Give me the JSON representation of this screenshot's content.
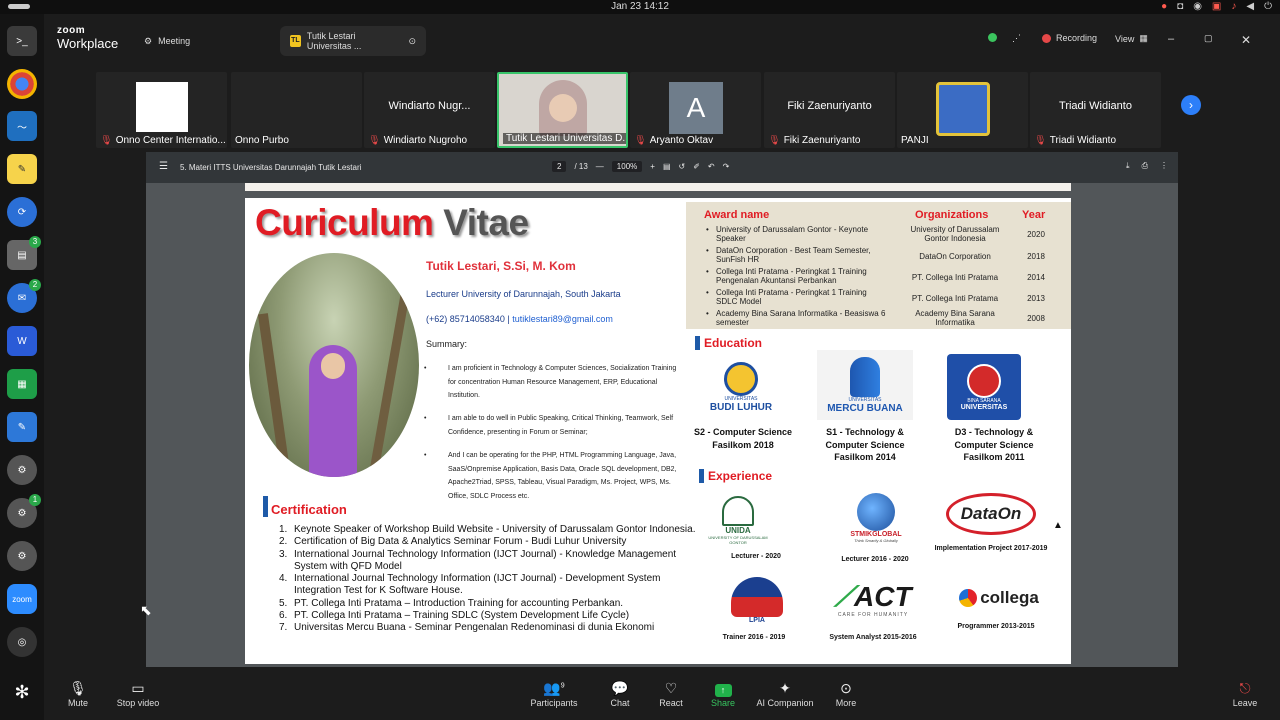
{
  "os": {
    "clock": "Jan 23  14:12"
  },
  "dock": {
    "badges": [
      "3",
      "2",
      "1"
    ],
    "zoom_label": "zoom"
  },
  "app": {
    "brand_line1": "zoom",
    "brand_line2": "Workplace",
    "tab_meeting": "Meeting",
    "tab_presentation": "Tutik Lestari Universitas ...",
    "tab_presentation_initials": "TL",
    "recording_label": "Recording",
    "view_label": "View"
  },
  "participants": [
    {
      "caption": "Onno Center Internatio...",
      "muted": true,
      "display": "logo"
    },
    {
      "caption": "Onno Purbo",
      "muted": false,
      "display": ""
    },
    {
      "caption": "Windiarto Nugroho",
      "muted": true,
      "display": "Windiarto Nugr..."
    },
    {
      "caption": "Tutik Lestari Universitas D...",
      "muted": false,
      "display": "video",
      "active": true
    },
    {
      "caption": "Aryanto Oktav",
      "muted": true,
      "display": "A"
    },
    {
      "caption": "Fiki Zaenuriyanto",
      "muted": true,
      "display": "Fiki Zaenuriyanto"
    },
    {
      "caption": "PANJI",
      "muted": false,
      "display": "logo"
    },
    {
      "caption": "Triadi Widianto",
      "muted": true,
      "display": "Triadi Widianto"
    }
  ],
  "pdf": {
    "file_title": "5. Materi ITTS Universitas Darunnajah Tutik Lestari",
    "page_current": "2",
    "page_total": "/ 13",
    "zoom": "100%"
  },
  "slide": {
    "title_part1": "Curiculum",
    "title_part2": "Vitae",
    "name": "Tutik Lestari, S.Si, M. Kom",
    "role": "Lecturer University of Darunnajah, South Jakarta",
    "phone": "(+62) 85714058340 |",
    "email": "tutiklestari89@gmail.com",
    "summary_heading": "Summary:",
    "summary": [
      "I am proficient in Technology & Computer Sciences, Socialization Training for concentration Human Resource Management, ERP, Educational Institution.",
      "I am able to do well in Public Speaking, Critical Thinking, Teamwork, Self Confidence, presenting in Forum or Seminar;",
      "And I can be operating for the PHP, HTML Programming Language, Java, SaaS/Onpremise Application, Basis Data, Oracle SQL development, DB2, Apache2Triad, SPSS, Tableau, Visual Paradigm, Ms. Project, WPS, Ms. Office, SDLC Process etc."
    ],
    "cert_heading": "Certification",
    "certifications": [
      "Keynote Speaker of Workshop Build Website - University of Darussalam Gontor Indonesia.",
      "Certification of Big Data & Analytics Seminar Forum - Budi Luhur University",
      "International Journal Technology Information (IJCT Journal) - Knowledge Management System with QFD Model",
      "International Journal Technology Information (IJCT Journal) - Development System Integration Test for K Software House.",
      "PT. Collega Inti Pratama – Introduction Training for accounting Perbankan.",
      "PT. Collega Inti Pratama – Training SDLC (System Development Life Cycle)",
      "Universitas Mercu Buana - Seminar Pengenalan Redenominasi di dunia Ekonomi"
    ],
    "awards_headers": {
      "name": "Award name",
      "org": "Organizations",
      "year": "Year"
    },
    "awards": [
      {
        "name": "University of Darussalam Gontor - Keynote Speaker",
        "org": "University of Darussalam Gontor Indonesia",
        "year": "2020"
      },
      {
        "name": "DataOn Corporation - Best Team Semester, SunFish HR",
        "org": "DataOn Corporation",
        "year": "2018"
      },
      {
        "name": "Collega Inti Pratama - Peringkat 1 Training Pengenalan Akuntansi Perbankan",
        "org": "PT. Collega Inti Pratama",
        "year": "2014"
      },
      {
        "name": "Collega Inti Pratama - Peringkat 1 Training SDLC Model",
        "org": "PT. Collega Inti Pratama",
        "year": "2013"
      },
      {
        "name": "Academy Bina Sarana Informatika - Beasiswa 6 semester",
        "org": "Academy Bina Sarana Informatika",
        "year": "2008"
      }
    ],
    "education_heading": "Education",
    "education": [
      {
        "logo_text": "UNIVERSITAS",
        "logo_name": "BUDI LUHUR",
        "caption": "S2 - Computer Science Fasilkom 2018"
      },
      {
        "logo_text": "UNIVERSITAS",
        "logo_name": "MERCU BUANA",
        "caption": "S1 - Technology & Computer Science Fasilkom 2014"
      },
      {
        "logo_text": "BINA SARANA",
        "logo_name": "UNIVERSITAS",
        "caption": "D3 - Technology & Computer Science Fasilkom 2011"
      }
    ],
    "experience_heading": "Experience",
    "experience": [
      {
        "logo": "UNIDA",
        "logo_sub": "UNIVERSITY OF DARUSSALAM GONTOR",
        "caption": "Lecturer - 2020"
      },
      {
        "logo": "STMIKGLOBAL",
        "logo_sub": "Think Smartly & Globally",
        "caption": "Lecturer 2016 - 2020"
      },
      {
        "logo": "DataOn",
        "logo_sub": "",
        "caption": "Implementation Project 2017-2019"
      },
      {
        "logo": "LPIA",
        "logo_sub": "",
        "caption": "Trainer 2016 - 2019"
      },
      {
        "logo": "ACT",
        "logo_sub": "CARE FOR HUMANITY",
        "caption": "System Analyst 2015-2016"
      },
      {
        "logo": "collega",
        "logo_sub": "",
        "caption": "Programmer 2013-2015"
      }
    ]
  },
  "toolbar": {
    "mute": "Mute",
    "stop_video": "Stop video",
    "participants": "Participants",
    "participants_count": "9",
    "chat": "Chat",
    "react": "React",
    "share": "Share",
    "ai": "AI Companion",
    "more": "More",
    "leave": "Leave"
  },
  "colors": {
    "accent_red": "#e01c24",
    "accent_blue": "#1e5aa8",
    "share_green": "#21b24b",
    "active_border": "#38c46a"
  }
}
